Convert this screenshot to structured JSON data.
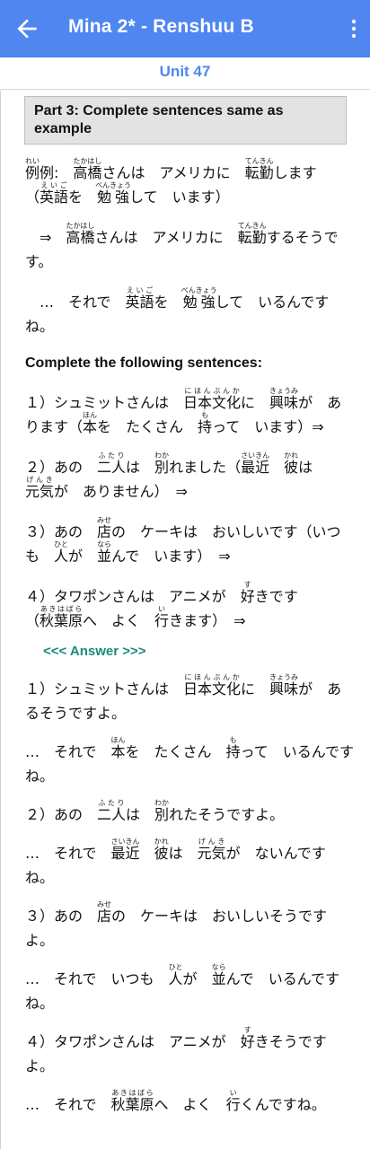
{
  "app_bar": {
    "title": "Mina 2* - Renshuu B",
    "back_icon": "arrow-left-icon",
    "menu_icon": "more-vert-icon"
  },
  "unit_label": "Unit 47",
  "part_title": "Part 3: Complete sentences same as example",
  "example": {
    "l1_a": "例:　",
    "l1_b": "さんは　アメリカに　",
    "l1_c": "します",
    "l2_a": "（",
    "l2_b": "を　",
    "l2_c": "して　います）",
    "l3_a": "　⇒　",
    "l3_b": "さんは　アメリカに　",
    "l3_c": "するそうです。",
    "l4_a": "　…　それで　",
    "l4_b": "を　",
    "l4_c": "して　いるんですね。"
  },
  "ruby": {
    "rei": "れい",
    "takahashi": "たかはし",
    "tenkin": "てんきん",
    "eigo": "えいご",
    "benkyou": "べんきょう",
    "nihonbunka": "にほんぶんか",
    "kyoumi": "きょうみ",
    "hon": "ほん",
    "mo": "も",
    "futari": "ふたり",
    "waka": "わか",
    "saikin": "さいきん",
    "kare": "かれ",
    "genki": "げんき",
    "mise": "みせ",
    "hito": "ひと",
    "nara": "なら",
    "su": "す",
    "akihabara": "あきはばら",
    "i": "い"
  },
  "kanji": {
    "rei": "例",
    "takahashi": "高橋",
    "tenkin": "転勤",
    "eigo": "英語",
    "benkyou": "勉強",
    "nihonbunka": "日本文化",
    "kyoumi": "興味",
    "hon": "本",
    "mo": "持",
    "futari": "二人",
    "waka": "別",
    "saikin": "最近",
    "kare": "彼",
    "genki": "元気",
    "mise": "店",
    "hito": "人",
    "nara": "並",
    "su": "好",
    "akihabara": "秋葉原",
    "i": "行"
  },
  "complete_heading": "Complete the following sentences:",
  "questions": {
    "q1_a": "１）シュミットさんは　",
    "q1_b": "に　",
    "q1_c": "が　あります（",
    "q1_d": "を　たくさん　",
    "q1_e": "って　います）⇒",
    "q2_a": "２）あの　",
    "q2_b": "は　",
    "q2_c": "れました（",
    "q2_d": "　",
    "q2_e": "は　",
    "q2_f": "が　ありません）　⇒",
    "q3_a": "３）あの　",
    "q3_b": "の　ケーキは　おいしいです（いつも　",
    "q3_c": "が　",
    "q3_d": "んで　います）　⇒",
    "q4_a": "４）タワポンさんは　アニメが　",
    "q4_b": "きです（",
    "q4_c": "へ　よく　",
    "q4_d": "きます）　⇒"
  },
  "answer_toggle": "<<< Answer >>>",
  "answers": {
    "a1_a": "１）シュミットさんは　",
    "a1_b": "に　",
    "a1_c": "が　あるそうですよ。",
    "a1f_a": "…　それで　",
    "a1f_b": "を　たくさん　",
    "a1f_c": "って　いるんですね。",
    "a2_a": "２）あの　",
    "a2_b": "は　",
    "a2_c": "れたそうですよ。",
    "a2f_a": "…　それで　",
    "a2f_b": "　",
    "a2f_c": "は　",
    "a2f_d": "が　ないんですね。",
    "a3_a": "３）あの　",
    "a3_b": "の　ケーキは　おいしいそうですよ。",
    "a3f_a": "…　それで　いつも　",
    "a3f_b": "が　",
    "a3f_c": "んで　いるんですね。",
    "a4_a": "４）タワポンさんは　アニメが　",
    "a4_b": "きそうですよ。",
    "a4f_a": "…　それで　",
    "a4f_b": "へ　よく　",
    "a4f_c": "くんですね。"
  }
}
